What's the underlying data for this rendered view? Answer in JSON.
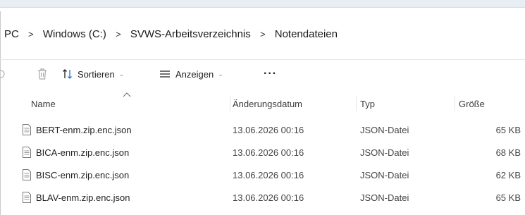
{
  "breadcrumb": {
    "items": [
      "PC",
      "Windows (C:)",
      "SVWS-Arbeitsverzeichnis",
      "Notendateien"
    ],
    "separator": ">"
  },
  "toolbar": {
    "sort_label": "Sortieren",
    "view_label": "Anzeigen",
    "more_label": "···"
  },
  "columns": {
    "name": "Name",
    "date": "Änderungsdatum",
    "type": "Typ",
    "size": "Größe"
  },
  "files": [
    {
      "name": "BERT-enm.zip.enc.json",
      "date": "13.06.2026 00:16",
      "type": "JSON-Datei",
      "size": "65 KB"
    },
    {
      "name": "BICA-enm.zip.enc.json",
      "date": "13.06.2026 00:16",
      "type": "JSON-Datei",
      "size": "68 KB"
    },
    {
      "name": "BISC-enm.zip.enc.json",
      "date": "13.06.2026 00:16",
      "type": "JSON-Datei",
      "size": "62 KB"
    },
    {
      "name": "BLAV-enm.zip.enc.json",
      "date": "13.06.2026 00:16",
      "type": "JSON-Datei",
      "size": "65 KB"
    }
  ]
}
